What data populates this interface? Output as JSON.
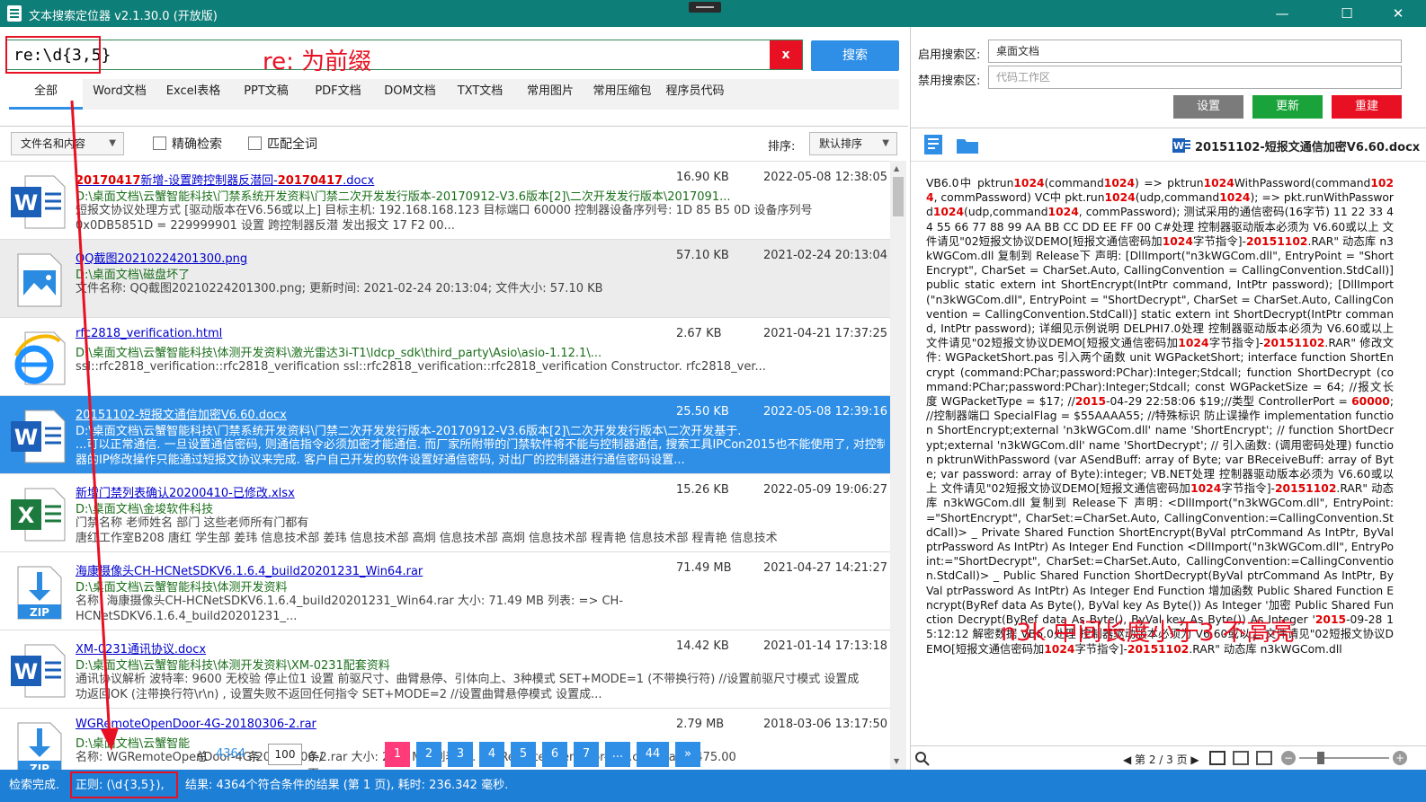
{
  "window": {
    "title": "文本搜索定位器 v2.1.30.0 (开放版)",
    "min": "—",
    "max": "☐",
    "close": "✕"
  },
  "search": {
    "query": "re:\\d{3,5}",
    "clear": "x",
    "button": "搜索",
    "annotation": "re: 为前缀"
  },
  "tabs": [
    "全部",
    "Word文档",
    "Excel表格",
    "PPT文稿",
    "PDF文档",
    "DOM文档",
    "TXT文档",
    "常用图片",
    "常用压缩包",
    "程序员代码"
  ],
  "filter": {
    "mode": "文件名和内容",
    "exact": "精确检索",
    "whole": "匹配全词",
    "sort_label": "排序:",
    "sort_value": "默认排序"
  },
  "results": [
    {
      "name_hl": "20170417",
      "name_rest": "新增-设置跨控制器反潜回-",
      "name_hl2": "20170417",
      "name_ext": ".docx",
      "size": "16.90 KB",
      "date": "2022-05-08 12:38:05",
      "path": "D:\\桌面文档\\云蟹智能科技\\门禁系统开发资料\\门禁二次开发发行版本-20170912-V3.6版本[2]\\二次开发发行版本\\2017091...",
      "snip1": "短报文协议处理方式 [驱动版本在V6.56或以上]    目标主机: 192.168.168.123    目标端口 60000    控制器设备序列号: 1D 85 B5 0D 设备序列号",
      "snip2": "0x0DB5851D = 229999901 设置 跨控制器反潜    发出报文    17 F2 00...",
      "icon": "word"
    },
    {
      "name": "QQ截图20210224201300.png",
      "size": "57.10 KB",
      "date": "2021-02-24 20:13:04",
      "path": "D:\\桌面文档\\磁盘坏了",
      "snip1": "文件名称: QQ截图20210224201300.png; 更新时间: 2021-02-24    20:13:04; 文件大小: 57.10 KB",
      "icon": "image"
    },
    {
      "name": "rfc2818_verification.html",
      "size": "2.67 KB",
      "date": "2021-04-21 17:37:25",
      "path": "D:\\桌面文档\\云蟹智能科技\\体测开发资料\\激光雷达3i-T1\\ldcp_sdk\\third_party\\Asio\\asio-1.12.1\\...",
      "snip1": "    ssl::rfc2818_verification::rfc2818_verification        ssl::rfc2818_verification::rfc2818_verification        Constructor.    rfc2818_ver...",
      "icon": "ie"
    },
    {
      "name": "20151102-短报文通信加密V6.60.docx",
      "size": "25.50 KB",
      "date": "2022-05-08 12:39:16",
      "path": "D:\\桌面文档\\云蟹智能科技\\门禁系统开发资料\\门禁二次开发发行版本-20170912-V3.6版本[2]\\二次开发发行版本\\二次开发基于...",
      "snip1": "...可以正常通信.    一旦设置通信密码, 则通信指令必须加密才能通信. 而厂家所附带的门禁软件将不能与控制器通信, 搜索工具IPCon2015也不能使用了, 对控制",
      "snip2": "器的IP修改操作只能通过短报文协议来完成. 客户自己开发的软件设置好通信密码, 对出厂的控制器进行通信密码设置...",
      "icon": "word"
    },
    {
      "name": "新增门禁列表确认20200410-已修改.xlsx",
      "size": "15.26 KB",
      "date": "2022-05-09 19:06:27",
      "path": "D:\\桌面文档\\金埈软件科技",
      "snip1": "门禁名称    老师姓名    部门    这些老师所有门都有",
      "snip2": "唐红工作室B208    唐红    学生部    姜玮    信息技术部    姜玮    信息技术部    高炯    信息技术部    高炯    信息技术部    程青艳    信息技术部    程青艳    信息技术",
      "icon": "excel"
    },
    {
      "name": "海康摄像头CH-HCNetSDKV6.1.6.4_build20201231_Win64.rar",
      "size": "71.49 MB",
      "date": "2021-04-27 14:21:27",
      "path": "D:\\桌面文档\\云蟹智能科技\\体测开发资料",
      "snip1": "名称: 海康摄像头CH-HCNetSDKV6.1.6.4_build20201231_Win64.rar    大小: 71.49 MB    列表: =>                    CH-",
      "snip2": "HCNetSDKV6.1.6.4_build20201231_...",
      "icon": "zip"
    },
    {
      "name": "XM-0231通讯协议.docx",
      "size": "14.42 KB",
      "date": "2021-01-14 17:13:18",
      "path": "D:\\桌面文档\\云蟹智能科技\\体测开发资料\\XM-0231配套资料",
      "snip1": "通讯协议解析    波特率: 9600 无校验 停止位1 设置 前驱尺寸、曲臂悬停、引体向上、3种模式    SET+MODE=1  (不带换行符)  //设置前驱尺寸模式    设置成",
      "snip2": "功返回OK  (注带换行符\\r\\n)    , 设置失败不返回任何指令    SET+MODE=2    //设置曲臂悬停模式    设置成...",
      "icon": "word"
    },
    {
      "name": "WGRemoteOpenDoor-4G-20180306-2.rar",
      "size": "2.79 MB",
      "date": "2018-03-06 13:17:50",
      "path": "D:\\桌面文档\\云蟹智能",
      "snip1": "名称: WGRemoteOpenDoor-4G-20180306-2.rar    大小: 2.79 MB    列表: ...  WGRemoteOpenDoor-4G\\.classpath,    475.00",
      "icon": "zip"
    }
  ],
  "pager": {
    "total_prefix": "总",
    "total": "4364",
    "total_suffix": "条",
    "per_page": "100",
    "per_suffix": "条/页",
    "pages": [
      "1",
      "2",
      "3",
      "4",
      "5",
      "6",
      "7",
      "...",
      "44",
      "»"
    ]
  },
  "status": {
    "done": "检索完成.",
    "regex": "正则: (\\d{3,5}),",
    "result": "结果: 4364个符合条件的结果 (第 1 页), 耗时: 236.342 毫秒."
  },
  "right": {
    "enable_label": "启用搜索区:",
    "enable_value": "桌面文档",
    "disable_label": "禁用搜索区:",
    "disable_placeholder": "代码工作区",
    "btn_settings": "设置",
    "btn_update": "更新",
    "btn_rebuild": "重建",
    "preview_title": "20151102-短报文通信加密V6.60.docx",
    "page_info": "◀ 第 2 / 3 页 ▶",
    "annotation": "n3k 中间长度小于3 不高亮"
  },
  "colors": {
    "titlebar": "#0e7e78",
    "accent": "#2f8fe6",
    "danger": "#e81123",
    "update": "#19a33a",
    "settings": "#7b7b7b",
    "highlight": "#e00000"
  }
}
